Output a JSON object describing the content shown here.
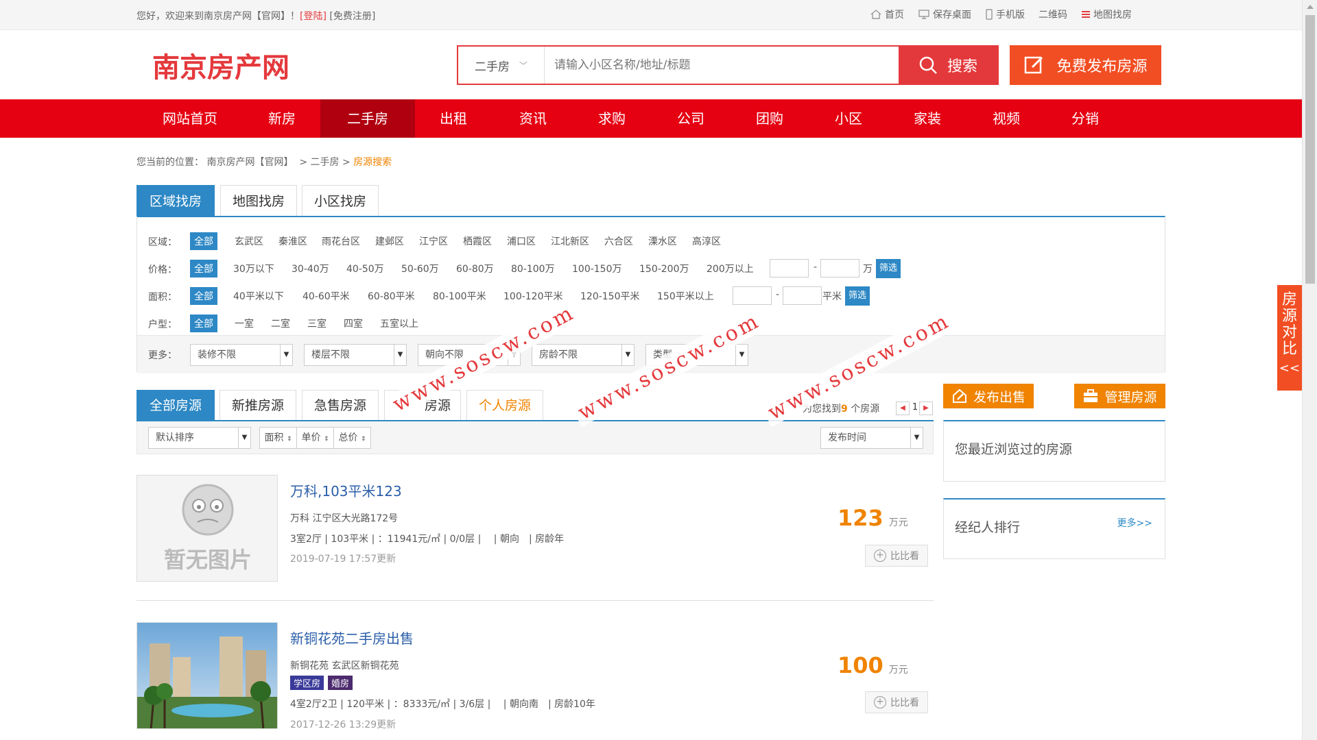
{
  "topbar": {
    "welcome_prefix": "您好，欢迎来到南京房产网【官网】！",
    "login": "[登陆]",
    "register": "[免费注册]",
    "links": [
      {
        "icon": "home-icon",
        "label": "首页"
      },
      {
        "icon": "monitor-icon",
        "label": "保存桌面"
      },
      {
        "icon": "phone-icon",
        "label": "手机版"
      },
      {
        "icon": "",
        "label": "二维码"
      },
      {
        "icon": "menu-icon",
        "label": "地图找房"
      }
    ]
  },
  "header": {
    "logo_text": "南京房产网",
    "search_type": "二手房",
    "search_placeholder": "请输入小区名称/地址/标题",
    "search_button": "搜索",
    "publish_button": "免费发布房源"
  },
  "nav": [
    "网站首页",
    "新房",
    "二手房",
    "出租",
    "资讯",
    "求购",
    "公司",
    "团购",
    "小区",
    "家装",
    "视频",
    "分销"
  ],
  "nav_active": "二手房",
  "breadcrumb": {
    "prefix": "您当前的位置：",
    "home": "南京房产网【官网】",
    "sep": ">",
    "level1": "二手房",
    "current": "房源搜索"
  },
  "search_tabs": [
    "区域找房",
    "地图找房",
    "小区找房"
  ],
  "filters": {
    "region": {
      "label": "区域：",
      "all": "全部",
      "options": [
        "玄武区",
        "秦淮区",
        "雨花台区",
        "建邺区",
        "江宁区",
        "栖霞区",
        "浦口区",
        "江北新区",
        "六合区",
        "溧水区",
        "高淳区"
      ]
    },
    "price": {
      "label": "价格：",
      "all": "全部",
      "options": [
        "30万以下",
        "30-40万",
        "40-50万",
        "50-60万",
        "60-80万",
        "80-100万",
        "100-150万",
        "150-200万",
        "200万以上"
      ],
      "dash": "-",
      "unit": "万",
      "button": "筛选"
    },
    "area": {
      "label": "面积：",
      "all": "全部",
      "options": [
        "40平米以下",
        "40-60平米",
        "60-80平米",
        "80-100平米",
        "100-120平米",
        "120-150平米",
        "150平米以上"
      ],
      "dash": "-",
      "unit": "平米",
      "button": "筛选"
    },
    "rooms": {
      "label": "户型：",
      "all": "全部",
      "options": [
        "一室",
        "二室",
        "三室",
        "四室",
        "五室以上"
      ]
    },
    "more": {
      "label": "更多：",
      "dropdowns": [
        "装修不限",
        "楼层不限",
        "朝向不限",
        "房龄不限",
        "类型"
      ]
    }
  },
  "listing_tabs": [
    "全部房源",
    "新推房源",
    "急售房源",
    "房源",
    "个人房源"
  ],
  "found": {
    "prefix": "为您找到",
    "count": "9",
    "suffix": "个房源",
    "page": "1"
  },
  "sort": {
    "default": "默认排序",
    "area": "面积",
    "unit_price": "单价",
    "total": "总价",
    "time": "发布时间"
  },
  "listings": [
    {
      "title": "万科,103平米123",
      "address": "万科 江宁区大光路172号",
      "meta": "3室2厅 | 103平米 | ：11941元/㎡ | 0/0层 |　 | 朝向　| 房龄年",
      "time": "2019-07-19 17:57更新",
      "price": "123",
      "price_unit": "万元",
      "compare": "比比看",
      "no_image": "暂无图片",
      "tags": []
    },
    {
      "title": "新铜花苑二手房出售",
      "address": "新铜花苑 玄武区新铜花苑",
      "meta": "4室2厅2卫 | 120平米 | ：8333元/㎡ | 3/6层 |　 | 朝向南　| 房龄10年",
      "time": "2017-12-26 13:29更新",
      "price": "100",
      "price_unit": "万元",
      "compare": "比比看",
      "tags": [
        "学区房",
        "婚房"
      ]
    }
  ],
  "sidebar": {
    "publish": "发布出售",
    "manage": "管理房源",
    "recent": "您最近浏览过的房源",
    "ranking": "经纪人排行",
    "more": "更多>>"
  },
  "compare_float": "房源对比",
  "compare_arrow": "<<",
  "watermark": "www.soscw.com",
  "colors": {
    "brand_red": "#e50012",
    "blue": "#2d88c5",
    "orange": "#f08300"
  }
}
